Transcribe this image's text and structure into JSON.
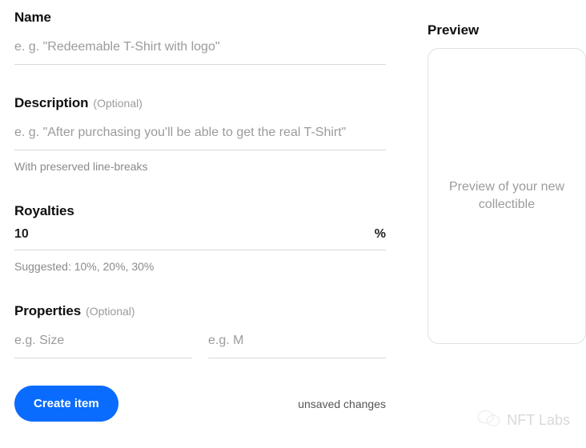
{
  "name": {
    "label": "Name",
    "placeholder": "e. g. \"Redeemable T-Shirt with logo\""
  },
  "description": {
    "label": "Description",
    "optional": "(Optional)",
    "placeholder": "e. g. \"After purchasing you'll be able to get the real T-Shirt\"",
    "hint": "With preserved line-breaks"
  },
  "royalties": {
    "label": "Royalties",
    "value": "10",
    "symbol": "%",
    "hint": "Suggested: 10%, 20%, 30%"
  },
  "properties": {
    "label": "Properties",
    "optional": "(Optional)",
    "key_placeholder": "e.g. Size",
    "val_placeholder": "e.g. M"
  },
  "actions": {
    "create_label": "Create item",
    "unsaved": "unsaved changes"
  },
  "preview": {
    "heading": "Preview",
    "message": "Preview of your new collectible"
  },
  "watermark": {
    "text": "NFT Labs"
  }
}
